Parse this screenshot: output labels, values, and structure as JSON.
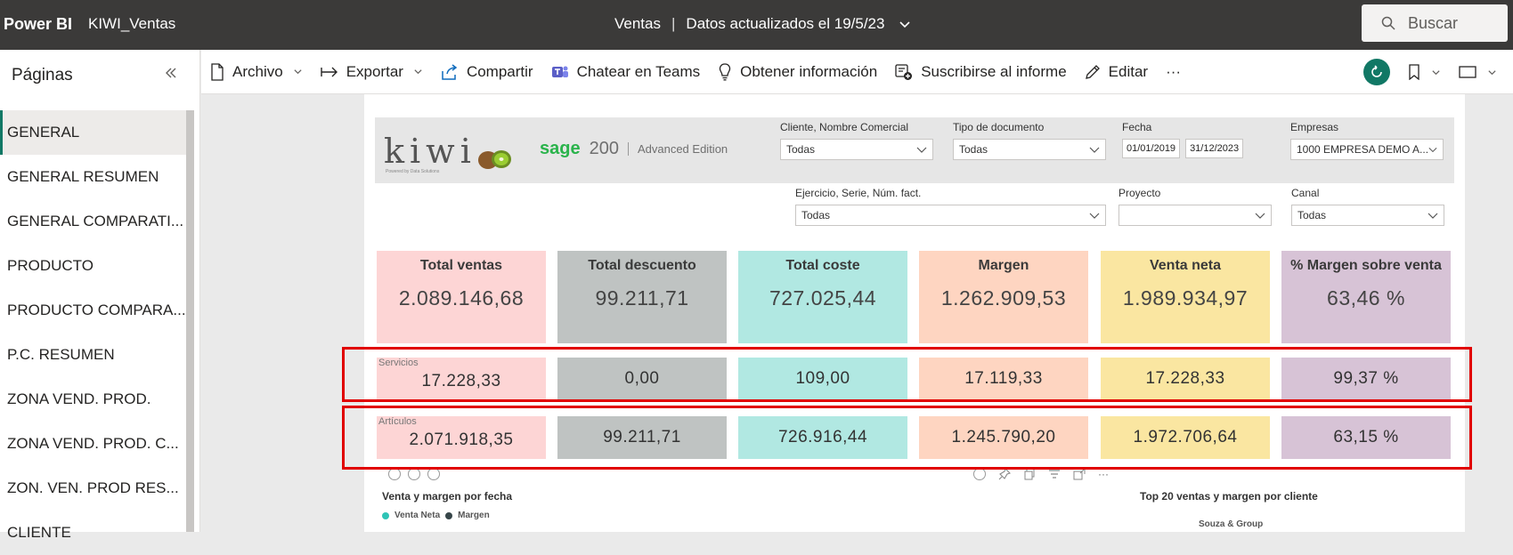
{
  "app": {
    "brand": "Power BI",
    "report_name": "KIWI_Ventas"
  },
  "header": {
    "report_page": "Ventas",
    "separator": "|",
    "updated": "Datos actualizados el 19/5/23"
  },
  "search": {
    "placeholder": "Buscar"
  },
  "sidebar": {
    "title": "Páginas",
    "items": [
      {
        "label": "GENERAL",
        "active": true
      },
      {
        "label": "GENERAL RESUMEN"
      },
      {
        "label": "GENERAL COMPARATI..."
      },
      {
        "label": "PRODUCTO"
      },
      {
        "label": "PRODUCTO COMPARA..."
      },
      {
        "label": "P.C. RESUMEN"
      },
      {
        "label": "ZONA VEND. PROD."
      },
      {
        "label": "ZONA VEND. PROD. C..."
      },
      {
        "label": "ZON. VEN. PROD RES..."
      },
      {
        "label": "CLIENTE"
      }
    ]
  },
  "actions": {
    "file": "Archivo",
    "export": "Exportar",
    "share": "Compartir",
    "teams": "Chatear en Teams",
    "insights": "Obtener información",
    "subscribe": "Suscribirse al informe",
    "edit": "Editar",
    "more": "···"
  },
  "report": {
    "logo_kiwi": "kiwi",
    "logo_kiwi_sub": "Powered by Data Solutions",
    "sage_brand": "sage",
    "sage_number": "200",
    "sage_edition": "Advanced Edition",
    "slicers": {
      "cliente": {
        "label": "Cliente, Nombre Comercial",
        "value": "Todas"
      },
      "tipo_doc": {
        "label": "Tipo de documento",
        "value": "Todas"
      },
      "fecha": {
        "label": "Fecha",
        "from": "01/01/2019",
        "to": "31/12/2023"
      },
      "empresas": {
        "label": "Empresas",
        "value": "1000 EMPRESA DEMO A..."
      },
      "ejercicio": {
        "label": "Ejercicio, Serie, Núm. fact.",
        "value": "Todas"
      },
      "proyecto": {
        "label": "Proyecto",
        "value": ""
      },
      "canal": {
        "label": "Canal",
        "value": "Todas"
      }
    },
    "kpis": [
      {
        "title": "Total ventas",
        "value": "2.089.146,68",
        "color": "#fdd5d5"
      },
      {
        "title": "Total descuento",
        "value": "99.211,71",
        "color": "#bfc3c2"
      },
      {
        "title": "Total coste",
        "value": "727.025,44",
        "color": "#b1e8e2"
      },
      {
        "title": "Margen",
        "value": "1.262.909,53",
        "color": "#fed5c1"
      },
      {
        "title": "Venta neta",
        "value": "1.989.934,97",
        "color": "#fae6a1"
      },
      {
        "title": "% Margen sobre venta",
        "value": "63,46 %",
        "color": "#d7c3d6"
      }
    ],
    "servicios": {
      "label": "Servicios",
      "values": [
        "17.228,33",
        "0,00",
        "109,00",
        "17.119,33",
        "17.228,33",
        "99,37 %"
      ]
    },
    "articulos": {
      "label": "Artículos",
      "values": [
        "2.071.918,35",
        "99.211,71",
        "726.916,44",
        "1.245.790,20",
        "1.972.706,64",
        "63,15 %"
      ]
    },
    "chart_left_title": "Venta y margen por fecha",
    "legend": [
      {
        "name": "Venta Neta",
        "color": "#2ec4b6"
      },
      {
        "name": "Margen",
        "color": "#374649"
      }
    ],
    "chart_right_title": "Top 20 ventas y margen por cliente",
    "chart_right_first_label": "Souza & Group"
  }
}
